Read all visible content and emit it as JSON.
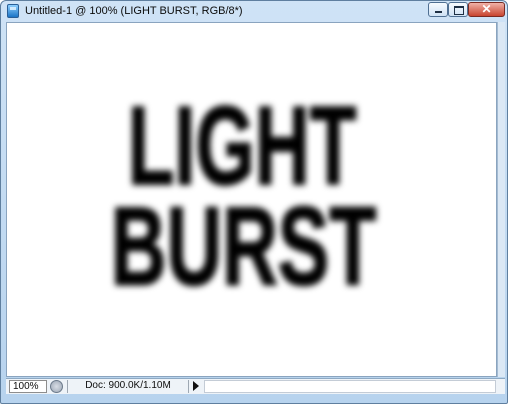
{
  "window": {
    "title": "Untitled-1 @ 100% (LIGHT BURST, RGB/8*)",
    "app_icon": "photoshop-document-icon",
    "controls": {
      "minimize_icon": "minimize-icon",
      "maximize_icon": "maximize-icon",
      "close_icon": "close-icon",
      "close_glyph": "✕"
    }
  },
  "canvas": {
    "text_line_1": "LIGHT",
    "text_line_2": "BURST",
    "text_color": "#000000",
    "background": "#ffffff"
  },
  "statusbar": {
    "zoom": "100%",
    "doc_info": "Doc: 900.0K/1.10M",
    "status_icon": "status-circle-icon",
    "menu_icon": "right-arrow-icon"
  }
}
